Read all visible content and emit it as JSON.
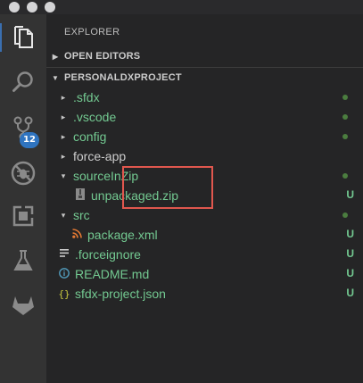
{
  "explorer": {
    "title": "EXPLORER",
    "open_editors": "OPEN EDITORS",
    "project": "PERSONALDXPROJECT"
  },
  "activity": {
    "scm_badge": "12"
  },
  "tree": [
    {
      "label": ".sfdx",
      "status": "dot"
    },
    {
      "label": ".vscode",
      "status": "dot"
    },
    {
      "label": "config",
      "status": "dot"
    },
    {
      "label": "force-app",
      "status": ""
    },
    {
      "label": "sourceInZip",
      "status": "dot"
    },
    {
      "label": "unpackaged.zip",
      "status": "U"
    },
    {
      "label": "src",
      "status": "dot"
    },
    {
      "label": "package.xml",
      "status": "U"
    },
    {
      "label": ".forceignore",
      "status": "U"
    },
    {
      "label": "README.md",
      "status": "U"
    },
    {
      "label": "sfdx-project.json",
      "status": "U"
    }
  ],
  "colors": {
    "untracked": "#73c991",
    "highlight_box": "#e0574e",
    "badge": "#2f74c0"
  }
}
